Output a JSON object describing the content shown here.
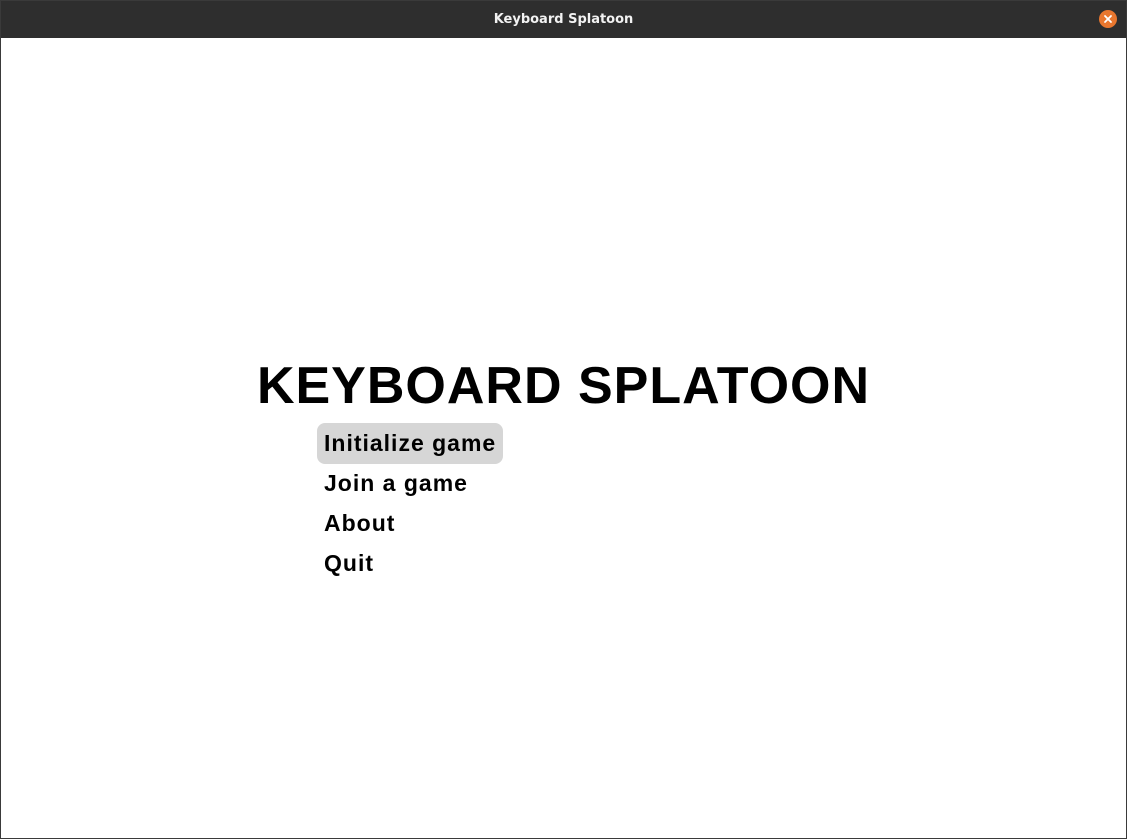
{
  "window": {
    "title": "Keyboard Splatoon",
    "close_icon": "close-icon",
    "close_color": "#e9772f",
    "titlebar_color": "#2e2e2e"
  },
  "game": {
    "title": "KEYBOARD SPLATOON"
  },
  "menu": {
    "selected_index": 0,
    "highlight_color": "#d6d6d6",
    "items": [
      {
        "label": "Initialize game"
      },
      {
        "label": "Join a game"
      },
      {
        "label": "About"
      },
      {
        "label": "Quit"
      }
    ]
  }
}
